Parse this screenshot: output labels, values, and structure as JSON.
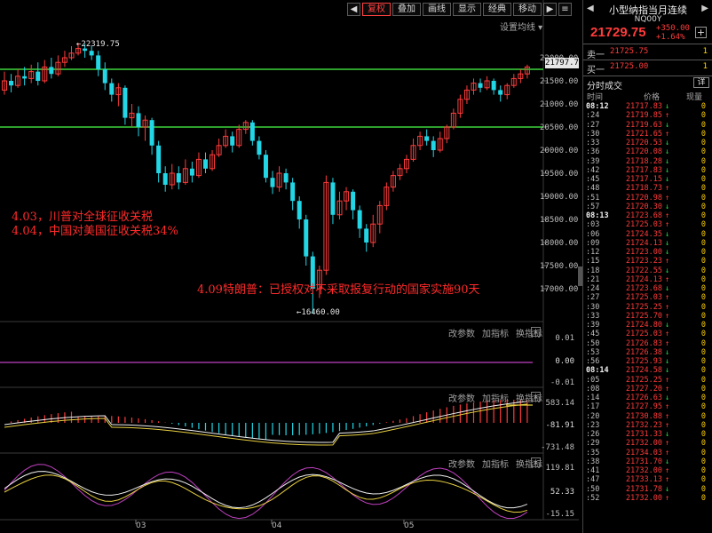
{
  "toolbar": {
    "buttons": [
      {
        "label": "复权",
        "active": true
      },
      {
        "label": "叠加"
      },
      {
        "label": "画线"
      },
      {
        "label": "显示"
      },
      {
        "label": "经典"
      },
      {
        "label": "移动"
      }
    ],
    "nav_icons": [
      "prev-icon",
      "next-icon",
      "menu-icon"
    ],
    "ma_setting": "设置均线"
  },
  "main_chart": {
    "y_axis_labels": [
      "22000.00",
      "21500.00",
      "21000.00",
      "20500.00",
      "20000.00",
      "19500.00",
      "19000.00",
      "18500.00",
      "18000.00",
      "17500.00",
      "17000.00"
    ],
    "current_price_tag": "21797.7",
    "high_tag": "←22319.75",
    "low_tag": "←16460.00",
    "support_lines": [
      21750,
      20500
    ],
    "annotations": [
      "4.03，川普对全球征收关税",
      "4.04，中国对美国征收关税34%",
      "4.09特朗普：已授权对不采取报复行动的国家实施90天"
    ]
  },
  "sub_charts": {
    "controls": [
      "改参数",
      "加指标",
      "换指标"
    ],
    "close_label": "×",
    "volume_panel": {
      "y_labels": [
        "0.01",
        "0.00",
        "-0.01"
      ]
    },
    "macd_panel": {
      "y_labels": [
        "583.14",
        "-81.91",
        "-731.48"
      ]
    },
    "kdj_panel": {
      "y_labels": [
        "119.81",
        "52.33",
        "-15.15"
      ]
    }
  },
  "x_axis_labels": [
    "03",
    "04",
    "05"
  ],
  "quote": {
    "title": "小型纳指当月连续",
    "code": "NQ00Y",
    "last": "21729.75",
    "change": "+350.00",
    "change_pct": "+1.64%",
    "plus_label": "+",
    "sell1": {
      "label": "卖一",
      "price": "21725.75",
      "vol": "1"
    },
    "buy1": {
      "label": "买一",
      "price": "21725.00",
      "vol": "1"
    },
    "fs_title": "分时成交",
    "fs_btn": "详",
    "headers": {
      "time": "时间",
      "price": "价格",
      "vol": "现量"
    }
  },
  "colors": {
    "up": "#ff3b3b",
    "down": "#20e050",
    "candle_down": "#22d6e6",
    "support": "#3ed63e",
    "vol_line": "#c040c0"
  },
  "trades": [
    {
      "t": "08:12",
      "p": "21717.83",
      "d": "dn",
      "v": "0"
    },
    {
      "t": ":24",
      "p": "21719.85",
      "d": "up",
      "v": "0"
    },
    {
      "t": ":27",
      "p": "21719.63",
      "d": "dn",
      "v": "0"
    },
    {
      "t": ":30",
      "p": "21721.65",
      "d": "up",
      "v": "0"
    },
    {
      "t": ":33",
      "p": "21720.53",
      "d": "dn",
      "v": "0"
    },
    {
      "t": ":36",
      "p": "21720.08",
      "d": "dn",
      "v": "0"
    },
    {
      "t": ":39",
      "p": "21718.28",
      "d": "dn",
      "v": "0"
    },
    {
      "t": ":42",
      "p": "21717.83",
      "d": "dn",
      "v": "0"
    },
    {
      "t": ":45",
      "p": "21717.15",
      "d": "dn",
      "v": "0"
    },
    {
      "t": ":48",
      "p": "21718.73",
      "d": "up",
      "v": "0"
    },
    {
      "t": ":51",
      "p": "21720.98",
      "d": "up",
      "v": "0"
    },
    {
      "t": ":57",
      "p": "21720.30",
      "d": "dn",
      "v": "0"
    },
    {
      "t": "08:13",
      "p": "21723.68",
      "d": "up",
      "v": "0"
    },
    {
      "t": ":03",
      "p": "21725.03",
      "d": "up",
      "v": "0"
    },
    {
      "t": ":06",
      "p": "21724.35",
      "d": "dn",
      "v": "0"
    },
    {
      "t": ":09",
      "p": "21724.13",
      "d": "dn",
      "v": "0"
    },
    {
      "t": ":12",
      "p": "21723.00",
      "d": "dn",
      "v": "0"
    },
    {
      "t": ":15",
      "p": "21723.23",
      "d": "up",
      "v": "0"
    },
    {
      "t": ":18",
      "p": "21722.55",
      "d": "dn",
      "v": "0"
    },
    {
      "t": ":21",
      "p": "21724.13",
      "d": "up",
      "v": "0"
    },
    {
      "t": ":24",
      "p": "21723.68",
      "d": "dn",
      "v": "0"
    },
    {
      "t": ":27",
      "p": "21725.03",
      "d": "up",
      "v": "0"
    },
    {
      "t": ":30",
      "p": "21725.25",
      "d": "up",
      "v": "0"
    },
    {
      "t": ":33",
      "p": "21725.70",
      "d": "up",
      "v": "0"
    },
    {
      "t": ":39",
      "p": "21724.80",
      "d": "dn",
      "v": "0"
    },
    {
      "t": ":45",
      "p": "21725.03",
      "d": "up",
      "v": "0"
    },
    {
      "t": ":50",
      "p": "21726.83",
      "d": "up",
      "v": "0"
    },
    {
      "t": ":53",
      "p": "21726.38",
      "d": "dn",
      "v": "0"
    },
    {
      "t": ":56",
      "p": "21725.93",
      "d": "dn",
      "v": "0"
    },
    {
      "t": "08:14",
      "p": "21724.58",
      "d": "dn",
      "v": "0"
    },
    {
      "t": ":05",
      "p": "21725.25",
      "d": "up",
      "v": "0"
    },
    {
      "t": ":08",
      "p": "21727.20",
      "d": "up",
      "v": "0"
    },
    {
      "t": ":14",
      "p": "21726.63",
      "d": "dn",
      "v": "0"
    },
    {
      "t": ":17",
      "p": "21727.95",
      "d": "up",
      "v": "0"
    },
    {
      "t": ":20",
      "p": "21730.88",
      "d": "up",
      "v": "0"
    },
    {
      "t": ":23",
      "p": "21732.23",
      "d": "up",
      "v": "0"
    },
    {
      "t": ":26",
      "p": "21731.33",
      "d": "dn",
      "v": "0"
    },
    {
      "t": ":29",
      "p": "21732.00",
      "d": "up",
      "v": "0"
    },
    {
      "t": ":35",
      "p": "21734.03",
      "d": "up",
      "v": "0"
    },
    {
      "t": ":38",
      "p": "21731.70",
      "d": "dn",
      "v": "0"
    },
    {
      "t": ":41",
      "p": "21732.00",
      "d": "up",
      "v": "0"
    },
    {
      "t": ":47",
      "p": "21733.13",
      "d": "up",
      "v": "0"
    },
    {
      "t": ":50",
      "p": "21731.78",
      "d": "dn",
      "v": "0"
    },
    {
      "t": ":52",
      "p": "21732.00",
      "d": "up",
      "v": "0"
    }
  ]
}
